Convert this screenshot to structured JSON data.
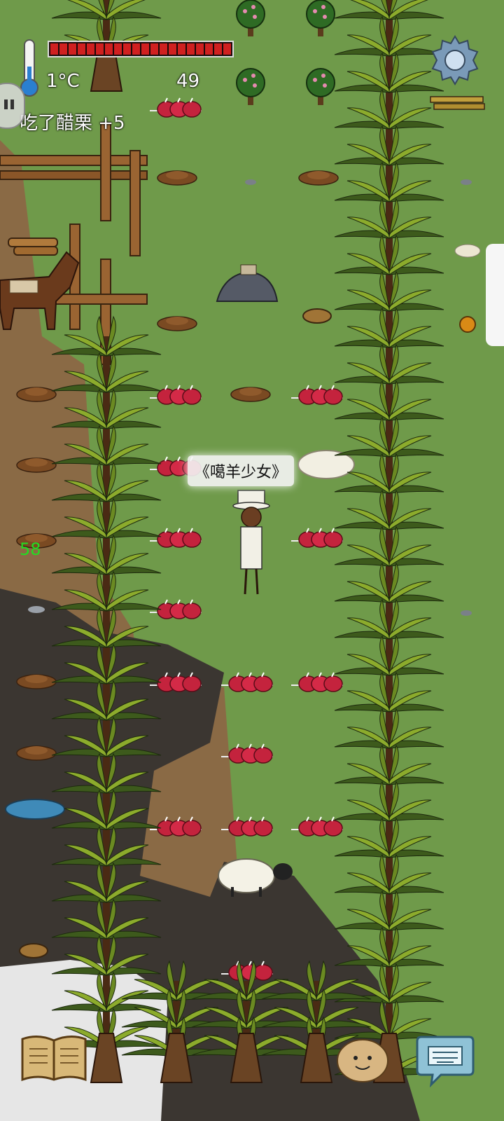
{
  "hud": {
    "temperature": "1°C",
    "age": "49",
    "status_message": "吃了醋栗 +5",
    "hunger_pips": 20,
    "hunger_filled": 20,
    "player_name": "《噶羊少女》",
    "other_player_age": "58"
  },
  "colors": {
    "grass": "#6f9a4a",
    "dirt": "#8a6a45",
    "dark_soil": "#3b3631",
    "snow": "#e6e6e6",
    "hunger_bar": "#d02020",
    "age_green": "#22dd22"
  },
  "icons": {
    "settings": "gear-icon",
    "recipe_book": "book-icon",
    "emote": "potato-face-icon",
    "keyboard": "keyboard-icon",
    "thermometer": "thermometer-icon",
    "voice": "speech-icon"
  }
}
